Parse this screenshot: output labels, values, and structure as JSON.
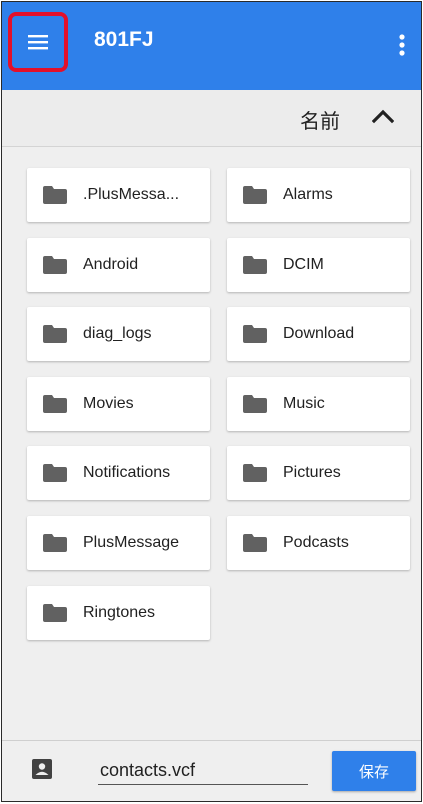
{
  "appbar": {
    "title": "801FJ",
    "menu_icon": "hamburger-menu-icon",
    "more_icon": "more-vert-icon",
    "color": "#2f80ea",
    "highlight_color": "#e3102b"
  },
  "sort": {
    "label": "名前",
    "direction_icon": "chevron-up-icon"
  },
  "folders": [
    {
      "label": ".PlusMessa..."
    },
    {
      "label": "Alarms"
    },
    {
      "label": "Android"
    },
    {
      "label": "DCIM"
    },
    {
      "label": "diag_logs"
    },
    {
      "label": "Download"
    },
    {
      "label": "Movies"
    },
    {
      "label": "Music"
    },
    {
      "label": "Notifications"
    },
    {
      "label": "Pictures"
    },
    {
      "label": "PlusMessage"
    },
    {
      "label": "Podcasts"
    },
    {
      "label": "Ringtones"
    }
  ],
  "bottom": {
    "filename_value": "contacts.vcf",
    "save_label": "保存",
    "contact_icon": "contact-card-icon"
  }
}
